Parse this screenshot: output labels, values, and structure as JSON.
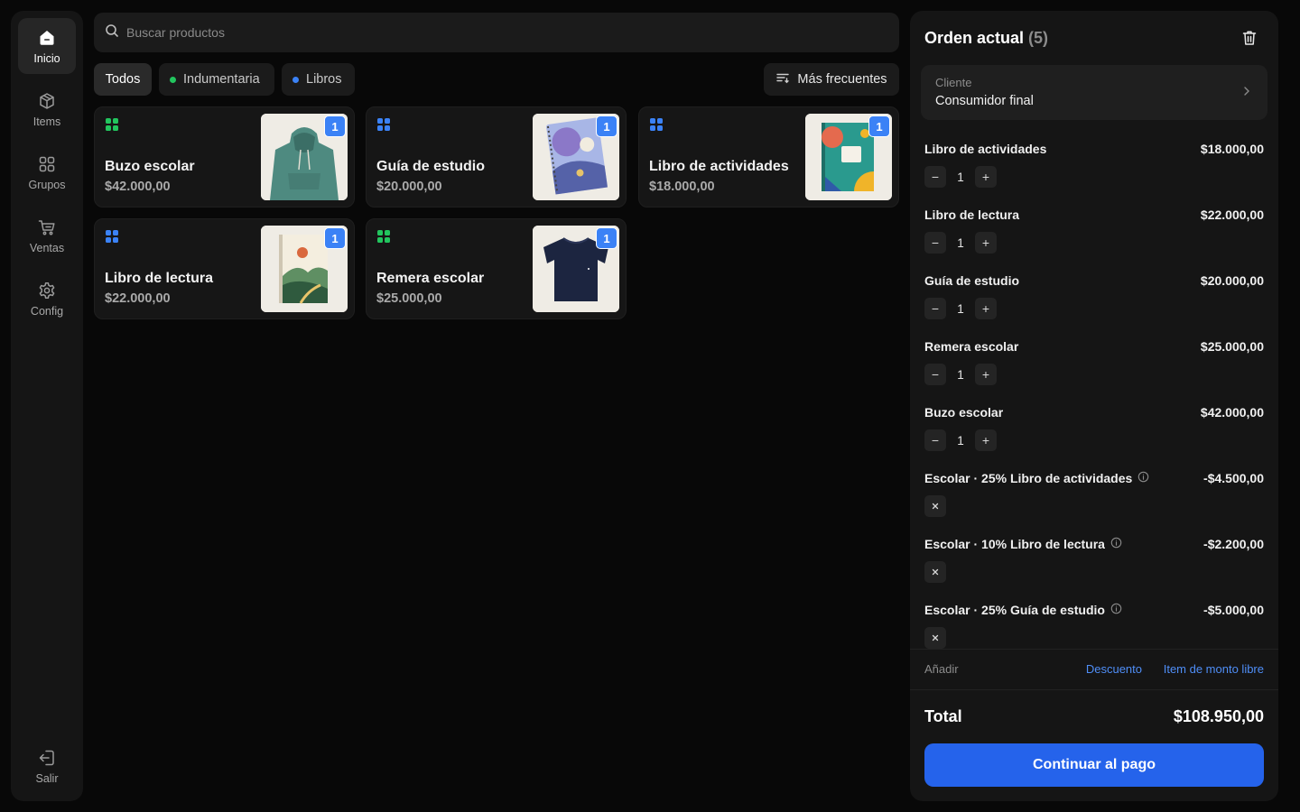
{
  "sidebar": {
    "items": [
      {
        "label": "Inicio",
        "icon": "home-icon",
        "active": true
      },
      {
        "label": "Items",
        "icon": "box-icon"
      },
      {
        "label": "Grupos",
        "icon": "grid-icon"
      },
      {
        "label": "Ventas",
        "icon": "cart-icon"
      },
      {
        "label": "Config",
        "icon": "gear-icon"
      }
    ],
    "logout_label": "Salir"
  },
  "search": {
    "placeholder": "Buscar productos",
    "value": ""
  },
  "filters": {
    "all": "Todos",
    "groups": [
      {
        "label": "Indumentaria",
        "color": "#22c55e"
      },
      {
        "label": "Libros",
        "color": "#3b82f6"
      }
    ],
    "sort_label": "Más frecuentes"
  },
  "products": [
    {
      "name": "Buzo escolar",
      "price": "$42.000,00",
      "qty": "1",
      "group_color": "#22c55e",
      "image": "hoodie"
    },
    {
      "name": "Guía de estudio",
      "price": "$20.000,00",
      "qty": "1",
      "group_color": "#3b82f6",
      "image": "notebook"
    },
    {
      "name": "Libro de actividades",
      "price": "$18.000,00",
      "qty": "1",
      "group_color": "#3b82f6",
      "image": "activity-book"
    },
    {
      "name": "Libro de lectura",
      "price": "$22.000,00",
      "qty": "1",
      "group_color": "#3b82f6",
      "image": "reading-book"
    },
    {
      "name": "Remera escolar",
      "price": "$25.000,00",
      "qty": "1",
      "group_color": "#22c55e",
      "image": "tshirt"
    }
  ],
  "order": {
    "title": "Orden actual",
    "count": "(5)",
    "customer_label": "Cliente",
    "customer_value": "Consumidor final",
    "lines": [
      {
        "name": "Libro de actividades",
        "amount": "$18.000,00",
        "qty": "1"
      },
      {
        "name": "Libro de lectura",
        "amount": "$22.000,00",
        "qty": "1"
      },
      {
        "name": "Guía de estudio",
        "amount": "$20.000,00",
        "qty": "1"
      },
      {
        "name": "Remera escolar",
        "amount": "$25.000,00",
        "qty": "1"
      },
      {
        "name": "Buzo escolar",
        "amount": "$42.000,00",
        "qty": "1"
      }
    ],
    "discounts": [
      {
        "name": "Escolar · 25% Libro de actividades",
        "amount": "-$4.500,00"
      },
      {
        "name": "Escolar · 10% Libro de lectura",
        "amount": "-$2.200,00"
      },
      {
        "name": "Escolar · 25% Guía de estudio",
        "amount": "-$5.000,00"
      }
    ],
    "add_label": "Añadir",
    "add_discount": "Descuento",
    "add_custom": "Item de monto libre",
    "total_label": "Total",
    "total_value": "$108.950,00",
    "pay_label": "Continuar al pago"
  },
  "colors": {
    "accent": "#2563eb",
    "badge": "#3b82f6",
    "green": "#22c55e"
  }
}
